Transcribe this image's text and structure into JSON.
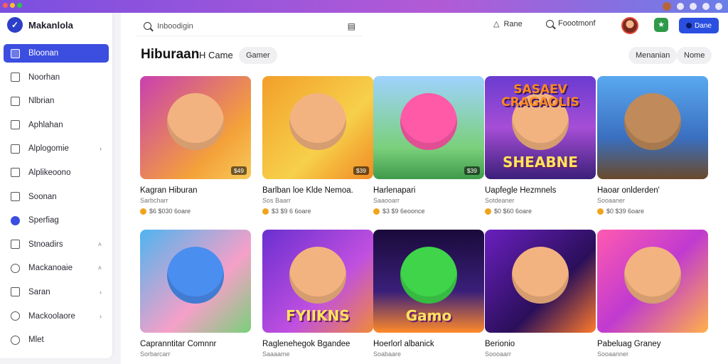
{
  "app": {
    "name": "Makanlola",
    "logo_icon": "check-circle-icon"
  },
  "colors": {
    "accent": "#3c4ee0",
    "cta": "#2a4fe0",
    "sidebar_active": "#3c4ee0"
  },
  "sidebar": {
    "items": [
      {
        "label": "Bloonan",
        "icon": "home-icon",
        "active": true
      },
      {
        "label": "Noorhan",
        "icon": "grid-icon"
      },
      {
        "label": "Nlbrian",
        "icon": "minus-box-icon"
      },
      {
        "label": "Aphlahan",
        "icon": "tag-icon"
      },
      {
        "label": "Alplogomie",
        "icon": "star-icon",
        "chevron": "›"
      },
      {
        "label": "Alplikeoono",
        "icon": "square-icon"
      },
      {
        "label": "Soonan",
        "icon": "square-icon"
      },
      {
        "label": "Sperfiag",
        "icon": "gear-icon"
      },
      {
        "label": "Stnoadirs",
        "icon": "folder-icon",
        "chevron": "˄"
      },
      {
        "label": "Mackanoaie",
        "icon": "globe-icon",
        "chevron": "˄"
      },
      {
        "label": "Saran",
        "icon": "image-icon",
        "chevron": "›"
      },
      {
        "label": "Mackoolaore",
        "icon": "globe-icon",
        "chevron": "›"
      },
      {
        "label": "Mlet",
        "icon": "circle-icon"
      }
    ]
  },
  "header": {
    "search_placeholder": "Inboodigin",
    "link1": "Rane",
    "link2": "Foootmonf",
    "cta_label": "Dane"
  },
  "page": {
    "title": "Hiburaan",
    "subtitle": "H Came",
    "filter_pill": "Gamer",
    "right_pill1": "Menanian",
    "right_pill2": "Nome"
  },
  "cards": [
    {
      "title": "Kagran Hiburan",
      "sub": "Sarbcharr",
      "meta": "$6 $030 6oare",
      "badge": "$49"
    },
    {
      "title": "Barlban loe Klde Nemoa.",
      "sub": "Sos Baarr",
      "meta": "$3 $9 6 6oare",
      "badge": "$39"
    },
    {
      "title": "Harlenapari",
      "sub": "Saaooarr",
      "meta": "$3 $9 6eoonce",
      "badge": "$39"
    },
    {
      "title": "Uapfegle Hezmnels",
      "sub": "Sotdeaner",
      "meta": "$0 $60 6oare",
      "top_text": "SASAEV CRAGAOLIS",
      "big_text": "SHEABNE"
    },
    {
      "title": "Haoar onlderden'",
      "sub": "Sooaaner",
      "meta": "$0 $39 6oare"
    },
    {
      "title": "Capranntitar Comnnr",
      "sub": "Sorbarcarr"
    },
    {
      "title": "Raglenehegok Bgandee",
      "sub": "Saaaame",
      "big_text": "FYIIKNS"
    },
    {
      "title": "Hoerlorl albanick",
      "sub": "Soabaare",
      "big_text": "Gamo"
    },
    {
      "title": "Berionio",
      "sub": "Soooaarr"
    },
    {
      "title": "Pabeluag Graney",
      "sub": "Sooaanner"
    }
  ]
}
